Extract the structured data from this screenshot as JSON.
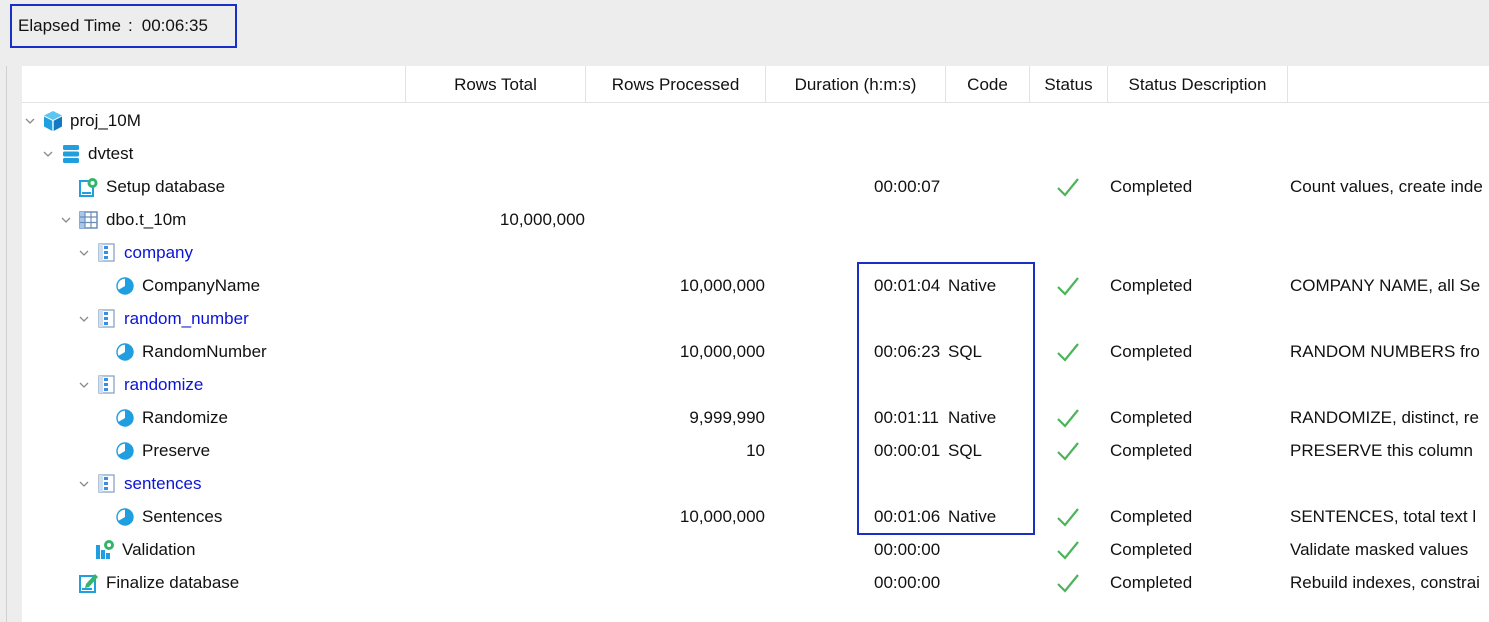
{
  "elapsed": {
    "label": "Elapsed Time",
    "separator": ":",
    "value": "00:06:35"
  },
  "columns": [
    "Rows Total",
    "Rows Processed",
    "Duration (h:m:s)",
    "Code",
    "Status",
    "Status Description"
  ],
  "rows": [
    {
      "name": "proj_10M",
      "icon": "cube-icon",
      "rows_total": "",
      "rows_processed": "",
      "duration": "",
      "code": "",
      "status": "",
      "description": ""
    },
    {
      "name": "dvtest",
      "icon": "database-icon",
      "rows_total": "",
      "rows_processed": "",
      "duration": "",
      "code": "",
      "status": "",
      "description": ""
    },
    {
      "name": "Setup database",
      "icon": "setup-gear-icon",
      "rows_total": "",
      "rows_processed": "",
      "duration": "00:00:07",
      "code": "",
      "status": "Completed",
      "description": "Count values, create inde"
    },
    {
      "name": "dbo.t_10m",
      "icon": "table-icon",
      "rows_total": "10,000,000",
      "rows_processed": "",
      "duration": "",
      "code": "",
      "status": "",
      "description": ""
    },
    {
      "name": "company",
      "icon": "column-group-icon",
      "rows_total": "",
      "rows_processed": "",
      "duration": "",
      "code": "",
      "status": "",
      "description": ""
    },
    {
      "name": "CompanyName",
      "icon": "mask-rule-icon",
      "rows_total": "",
      "rows_processed": "10,000,000",
      "duration": "00:01:04",
      "code": "Native",
      "status": "Completed",
      "description": "COMPANY NAME, all Se"
    },
    {
      "name": "random_number",
      "icon": "column-group-icon",
      "rows_total": "",
      "rows_processed": "",
      "duration": "",
      "code": "",
      "status": "",
      "description": ""
    },
    {
      "name": "RandomNumber",
      "icon": "mask-rule-icon",
      "rows_total": "",
      "rows_processed": "10,000,000",
      "duration": "00:06:23",
      "code": "SQL",
      "status": "Completed",
      "description": "RANDOM NUMBERS fro"
    },
    {
      "name": "randomize",
      "icon": "column-group-icon",
      "rows_total": "",
      "rows_processed": "",
      "duration": "",
      "code": "",
      "status": "",
      "description": ""
    },
    {
      "name": "Randomize",
      "icon": "mask-rule-icon",
      "rows_total": "",
      "rows_processed": "9,999,990",
      "duration": "00:01:11",
      "code": "Native",
      "status": "Completed",
      "description": "RANDOMIZE, distinct, re"
    },
    {
      "name": "Preserve",
      "icon": "mask-rule-icon",
      "rows_total": "",
      "rows_processed": "10",
      "duration": "00:00:01",
      "code": "SQL",
      "status": "Completed",
      "description": "PRESERVE this column"
    },
    {
      "name": "sentences",
      "icon": "column-group-icon",
      "rows_total": "",
      "rows_processed": "",
      "duration": "",
      "code": "",
      "status": "",
      "description": ""
    },
    {
      "name": "Sentences",
      "icon": "mask-rule-icon",
      "rows_total": "",
      "rows_processed": "10,000,000",
      "duration": "00:01:06",
      "code": "Native",
      "status": "Completed",
      "description": "SENTENCES, total text l"
    },
    {
      "name": "Validation",
      "icon": "validation-gear-icon",
      "rows_total": "",
      "rows_processed": "",
      "duration": "00:00:00",
      "code": "",
      "status": "Completed",
      "description": "Validate masked values"
    },
    {
      "name": "Finalize database",
      "icon": "finalize-edit-icon",
      "rows_total": "",
      "rows_processed": "",
      "duration": "00:00:00",
      "code": "",
      "status": "Completed",
      "description": "Rebuild indexes, constrai"
    }
  ],
  "colors": {
    "link_blue": "#0a14d6",
    "check_green": "#4cb45a",
    "icon_blue": "#1f9ee0",
    "highlight_border": "#1a2ec8"
  }
}
